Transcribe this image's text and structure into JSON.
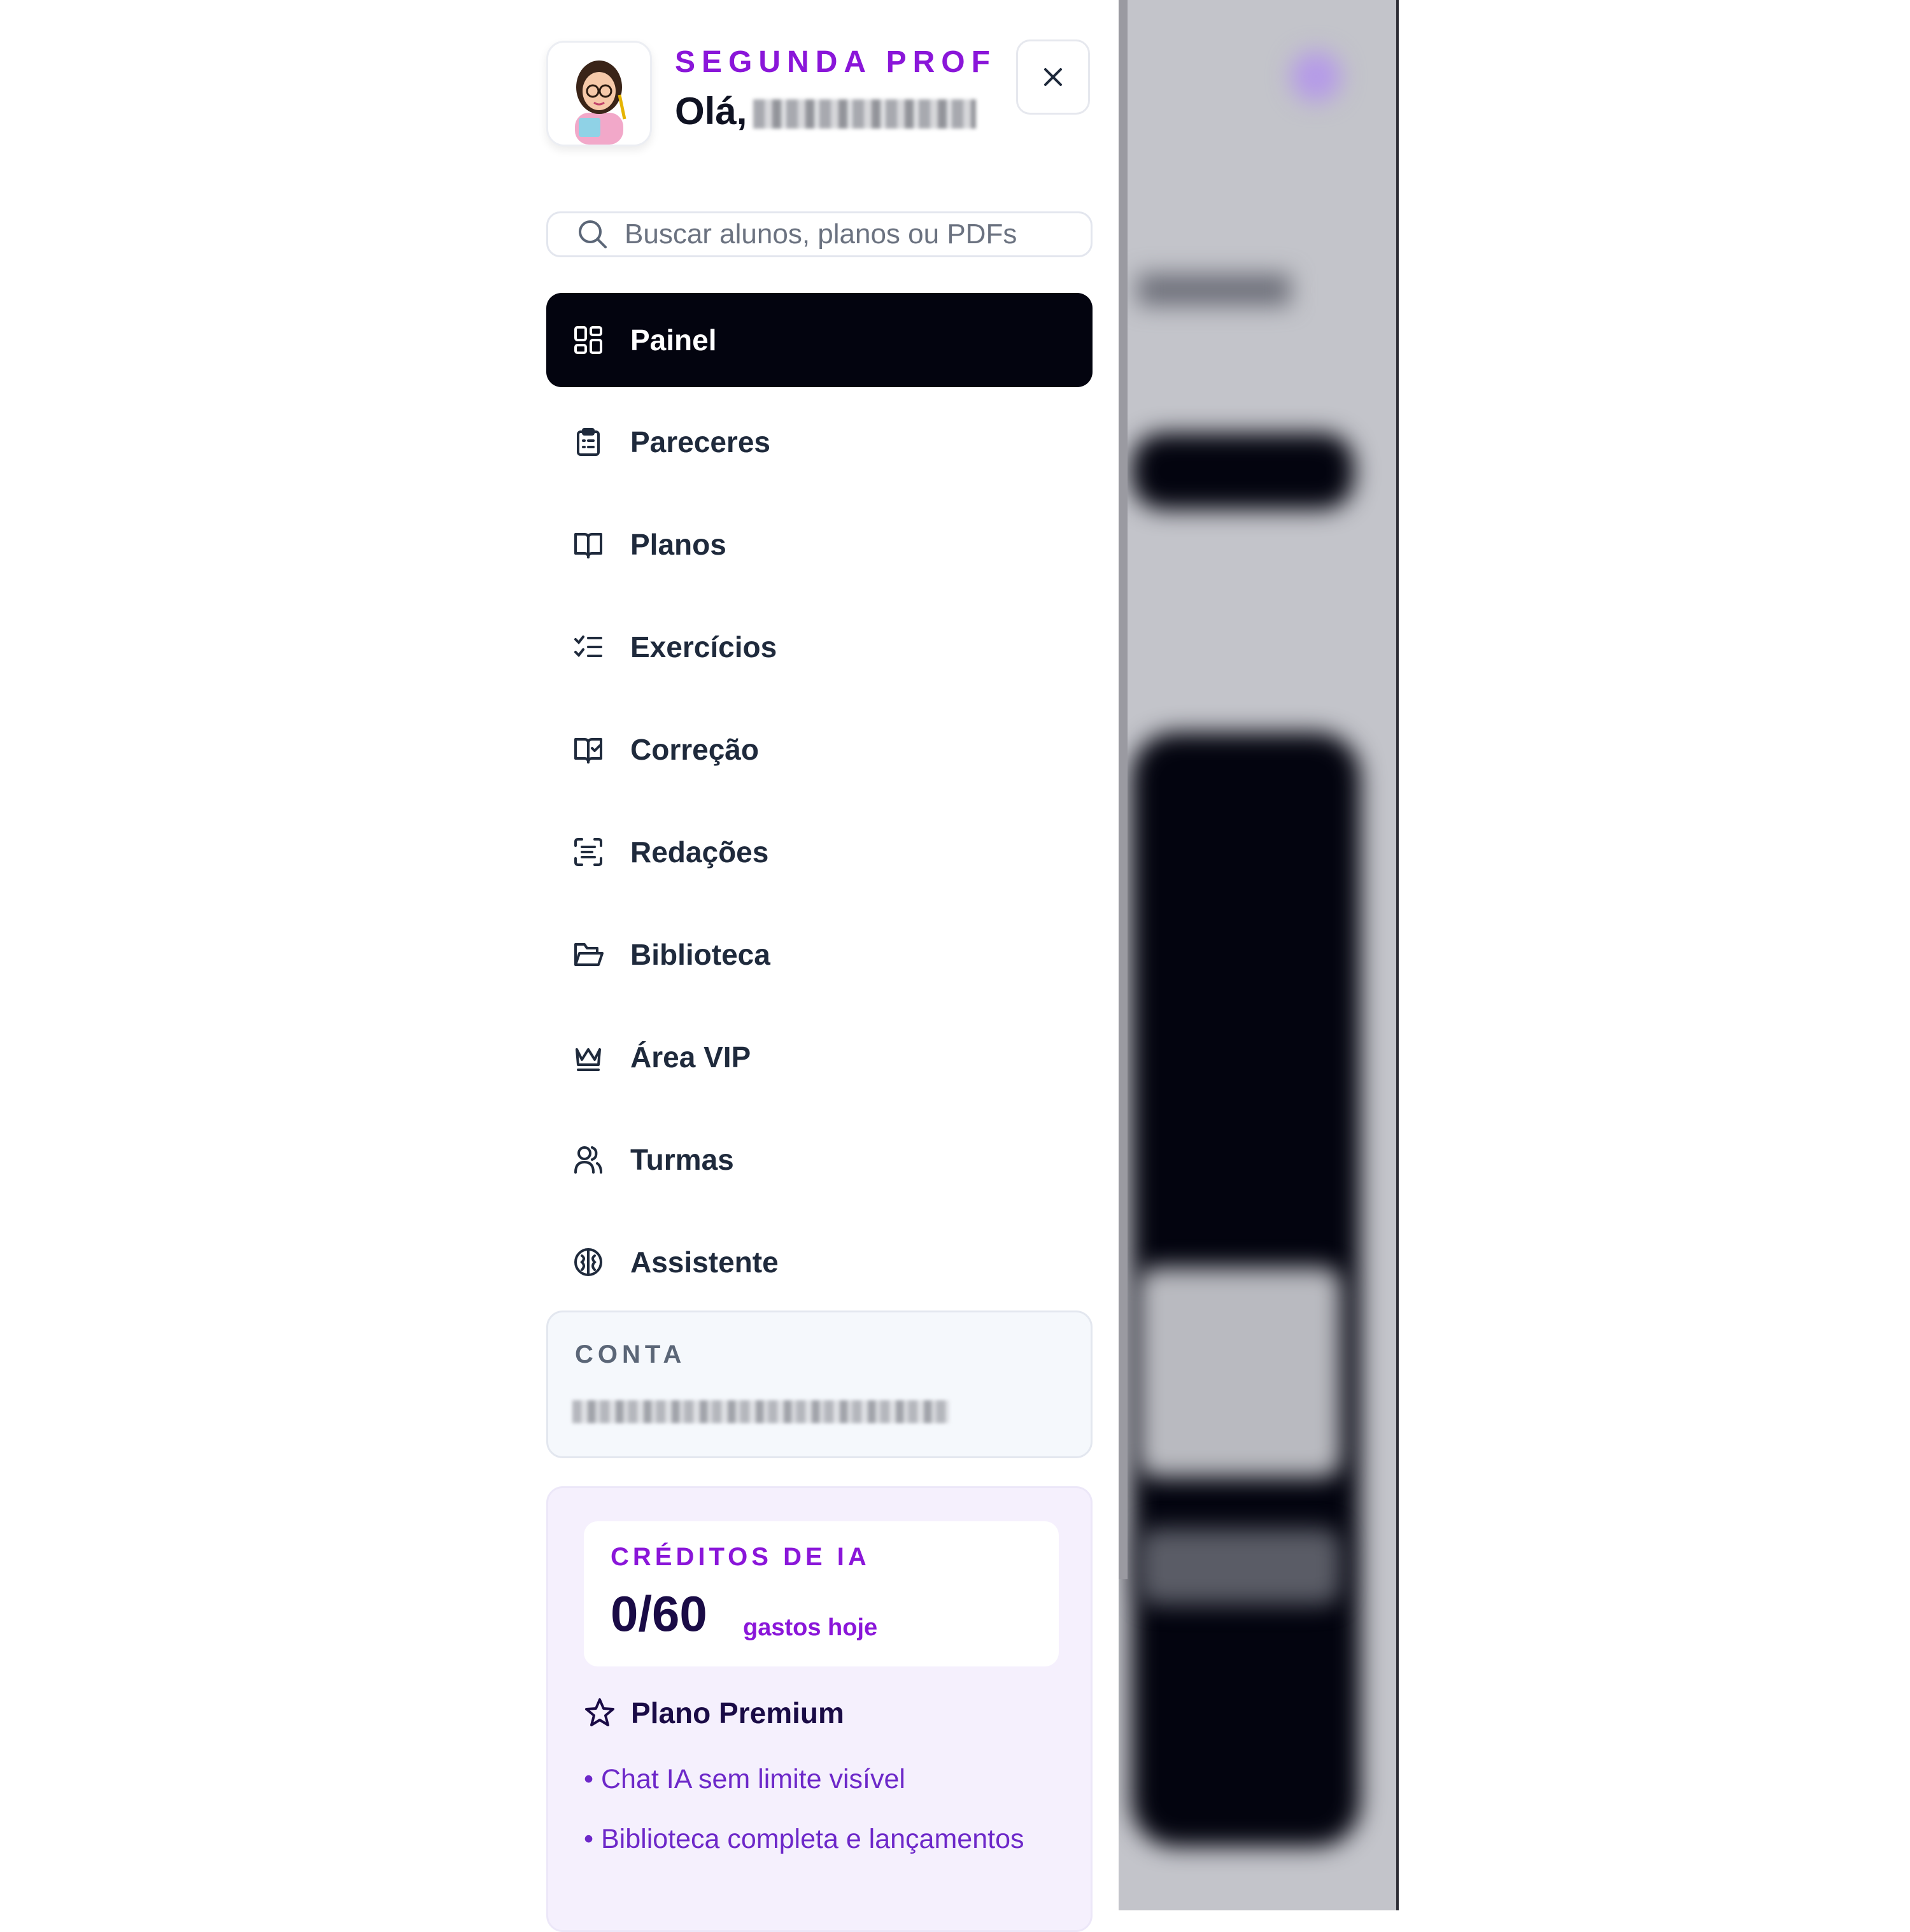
{
  "brand": "SEGUNDA PROF",
  "greeting_prefix": "Olá,",
  "search": {
    "placeholder": "Buscar alunos, planos ou PDFs"
  },
  "nav": [
    {
      "label": "Painel",
      "icon": "dashboard-grid-icon",
      "active": true
    },
    {
      "label": "Pareceres",
      "icon": "clipboard-list-icon"
    },
    {
      "label": "Planos",
      "icon": "open-book-icon"
    },
    {
      "label": "Exercícios",
      "icon": "checklist-icon"
    },
    {
      "label": "Correção",
      "icon": "book-check-icon"
    },
    {
      "label": "Redações",
      "icon": "scan-text-icon"
    },
    {
      "label": "Biblioteca",
      "icon": "folder-open-icon"
    },
    {
      "label": "Área VIP",
      "icon": "crown-icon"
    },
    {
      "label": "Turmas",
      "icon": "users-icon"
    },
    {
      "label": "Assistente",
      "icon": "brain-icon"
    }
  ],
  "account": {
    "title": "CONTA"
  },
  "credits": {
    "title": "CRÉDITOS DE IA",
    "count": "0/60",
    "suffix": "gastos hoje"
  },
  "plan": {
    "label": "Plano Premium",
    "perks": [
      "• Chat IA sem limite visível",
      "• Biblioteca completa e lançamentos"
    ]
  },
  "colors": {
    "accent": "#8a16d9",
    "active_bg": "#03040f",
    "nav_text": "#1f2a3c",
    "dark_purple": "#1a0b46"
  }
}
